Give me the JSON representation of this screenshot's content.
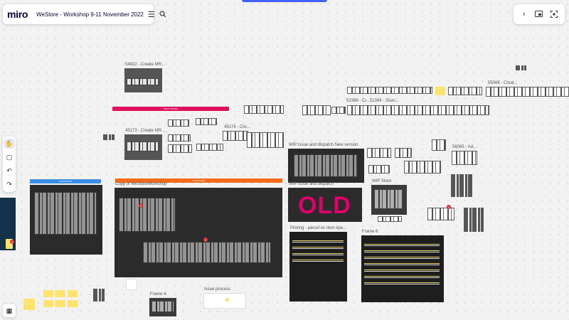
{
  "app": {
    "logo": "miro",
    "board_title": "WeStore - Workshop 9-11 November 2022"
  },
  "toolbar": {
    "menu_icon": "hamburger-icon",
    "search_icon": "search-icon",
    "right_icons": [
      "chevron-right-icon",
      "share-screen-icon",
      "fit-screen-icon"
    ]
  },
  "left_tools": [
    "hand-icon",
    "comment-icon",
    "undo-icon",
    "redo-icon"
  ],
  "frames": {
    "f54822": "54822 - Create MR...",
    "f45173": "45173 - Create MR...",
    "f45174": "45174 - Cre...",
    "f52386": "52386 - Cr...",
    "f52394": "52394 - Scan...",
    "f55068": "55068  -  Creat...",
    "f56085": "56085 - Ad...",
    "wip_new": "WIP Issue and dispatch New version",
    "wip_dispatch": "WIP Issue and dispatch",
    "wip_store": "WIP Store",
    "picking": "Picking - parcel on item ope...",
    "frame6": "Frame 6",
    "frame4": "Frame 4",
    "issue_process": "Issue process",
    "copy_workshop": "Copy of WeStoreWorkshop",
    "old": "OLD"
  },
  "colors": {
    "accent": "#4262ff",
    "old": "#e0006b",
    "banner_pink": "#e0105e",
    "banner_orange": "#f26a1b",
    "banner_blue": "#3a8ee6"
  }
}
